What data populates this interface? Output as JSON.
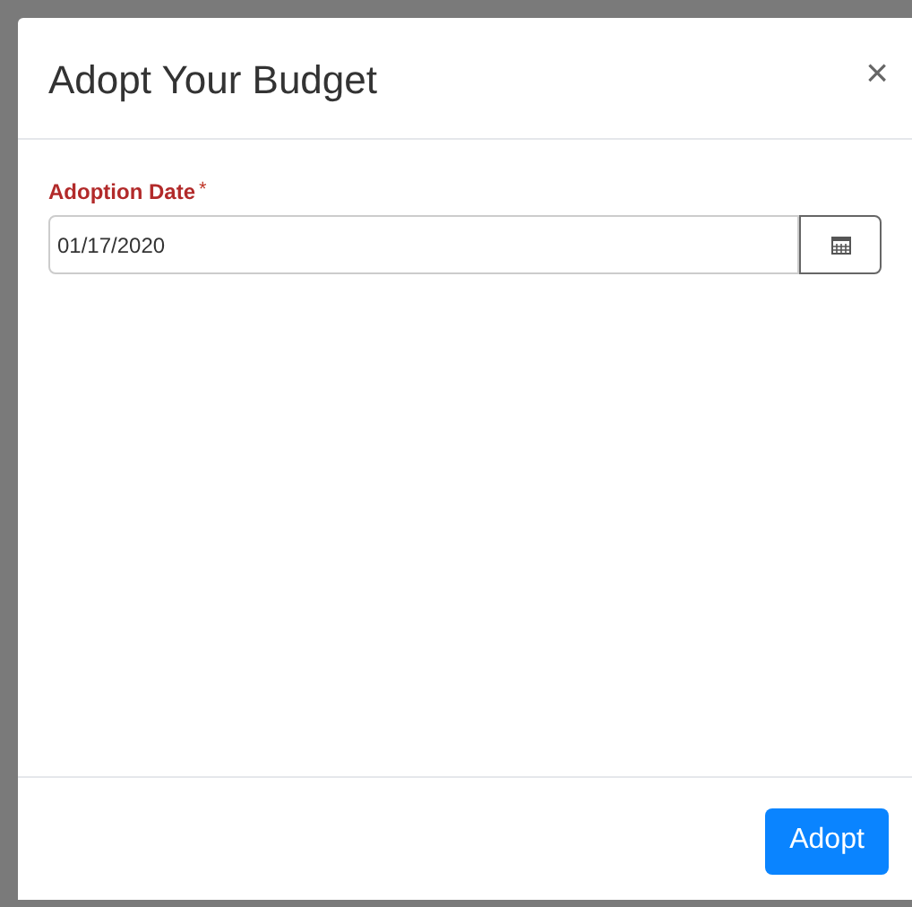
{
  "dialog": {
    "title": "Adopt Your Budget",
    "close": "×"
  },
  "field": {
    "label": "Adoption Date",
    "required_mark": "*",
    "value": "01/17/2020"
  },
  "buttons": [
    "Adopt"
  ]
}
